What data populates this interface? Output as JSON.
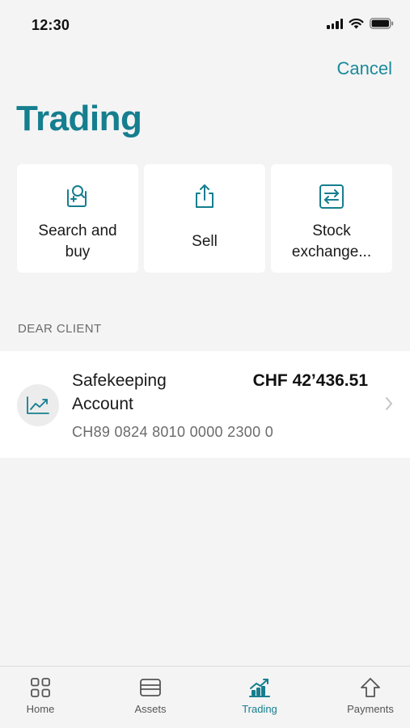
{
  "status_bar": {
    "time": "12:30"
  },
  "header": {
    "cancel_label": "Cancel",
    "title": "Trading"
  },
  "actions": [
    {
      "label": "Search and buy",
      "icon": "search-buy-icon"
    },
    {
      "label": "Sell",
      "icon": "share-sell-icon"
    },
    {
      "label": "Stock exchange...",
      "icon": "exchange-icon"
    }
  ],
  "section": {
    "header": "DEAR CLIENT"
  },
  "account": {
    "name": "Safekeeping Account",
    "amount": "CHF 42’436.51",
    "iban": "CH89 0824 8010 0000 2300 0",
    "icon": "chart-line-icon"
  },
  "tab_bar": {
    "items": [
      {
        "label": "Home",
        "icon": "grid-icon"
      },
      {
        "label": "Assets",
        "icon": "wallet-icon"
      },
      {
        "label": "Trading",
        "icon": "trading-chart-icon"
      },
      {
        "label": "Payments",
        "icon": "arrow-up-icon"
      }
    ],
    "active": "Trading"
  },
  "colors": {
    "accent": "#157e8f",
    "background": "#f4f4f4",
    "card": "#ffffff"
  }
}
